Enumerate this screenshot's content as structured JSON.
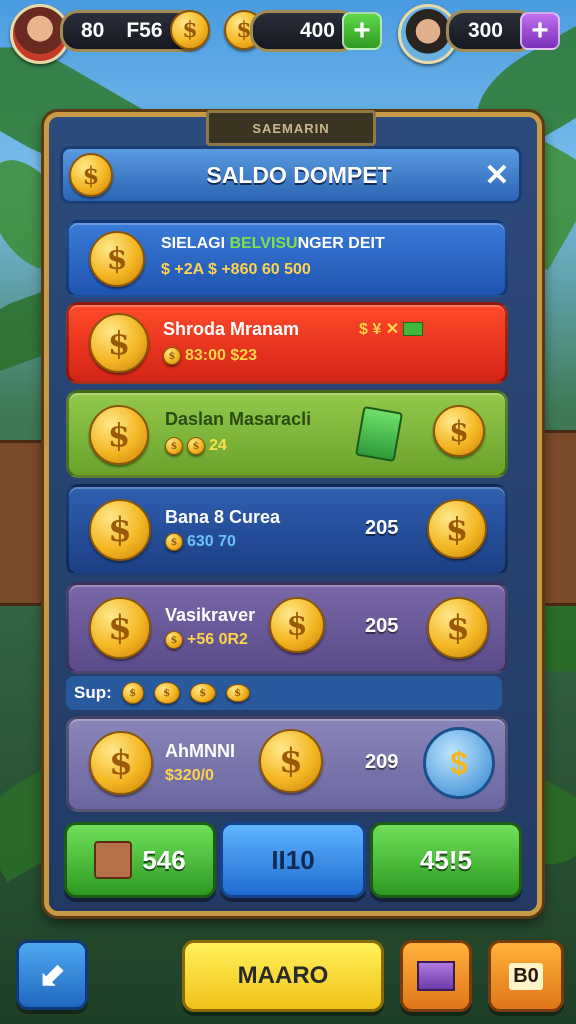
{
  "top_bar": {
    "player_left": {
      "value_a": "80",
      "value_b": "F56"
    },
    "coins_mid": {
      "value": "400"
    },
    "player_right": {
      "value": "300"
    }
  },
  "panel": {
    "tab_label": "SAEMARIN",
    "title": "SALDO DOMPET"
  },
  "rows": [
    {
      "title_a": "SIELAGI ",
      "title_highlight": "BELVISU",
      "title_b": "NGER DEIT",
      "sub": "$ +2A  $ +860 60 500"
    },
    {
      "title": "Shroda  Mranam",
      "sub": "83:00 $23",
      "badge": "$ ¥ ✕"
    },
    {
      "title": "Daslan Masaracli",
      "sub": "24"
    },
    {
      "title": "Bana 8 Curea",
      "sub": "630 70",
      "value": "205"
    },
    {
      "title": "Vasikraver",
      "sub": "+56 0R2",
      "value": "205"
    },
    {
      "title": "AhMNNI",
      "sub": "$320/0",
      "value": "209"
    }
  ],
  "coin_strip": {
    "label": "Sup:"
  },
  "bottom_buttons": [
    {
      "label": "546",
      "color": "#3fb83a"
    },
    {
      "label": "II10",
      "color": "#2f8fe0"
    },
    {
      "label": "45!5",
      "color": "#3fb83a"
    }
  ],
  "footer": {
    "center_label": "MAARO",
    "right_label": "B0"
  },
  "colors": {
    "gold_border": "#c99a45",
    "panel_blue": "#2d4a7c",
    "red_row": "#e6301f",
    "green_row": "#7bb63a",
    "purple_row": "#6f5d9a"
  }
}
